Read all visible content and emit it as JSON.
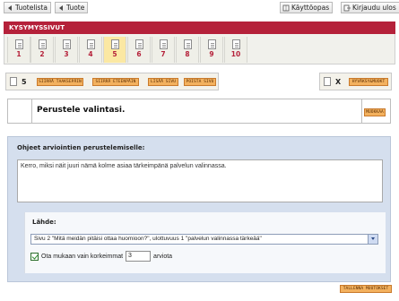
{
  "topnav": {
    "print_list": "Tuotelista",
    "print": "Tuote",
    "help": "Käyttöopas",
    "logout": "Kirjaudu ulos"
  },
  "section_title": "KYSYMYSSIVUT",
  "pages": [
    "1",
    "2",
    "3",
    "4",
    "5",
    "6",
    "7",
    "8",
    "9",
    "10"
  ],
  "current_page": "5",
  "controls": {
    "page_number": "5",
    "move_earlier": "SIIRRÄ TAAKSEPÄIN",
    "move_later": "SIIRRÄ ETEENPÄIN",
    "add_page": "LISÄÄ SIVU",
    "delete_page": "POISTA SIVU",
    "close_mark": "X",
    "approve": "HYVÄKSY&MUOKT"
  },
  "question": {
    "title": "Perustele valintasi.",
    "edit": "MUOKKAA"
  },
  "form": {
    "instructions_label": "Ohjeet arviointien perustelemiselle:",
    "instructions_text": "Kerro, miksi näit juuri nämä kolme asiaa tärkeimpänä palvelun valinnassa.",
    "source_label": "Lähde:",
    "source_value": "Sivu 2 \"Mitä meidän pitäisi ottaa huomioon?\", ulottuvuus 1 \"palvelun valinnassa tärkeää\"",
    "limit_before": "Ota mukaan vain korkeimmat",
    "limit_value": "3",
    "limit_after": "arviota",
    "save": "TALLENNA MUUTOKSET"
  },
  "colors": {
    "header_red": "#b5213a",
    "current_page": "#fbe8a3",
    "orange_button": "#f3b15e",
    "panel_blue": "#d5dfee"
  }
}
